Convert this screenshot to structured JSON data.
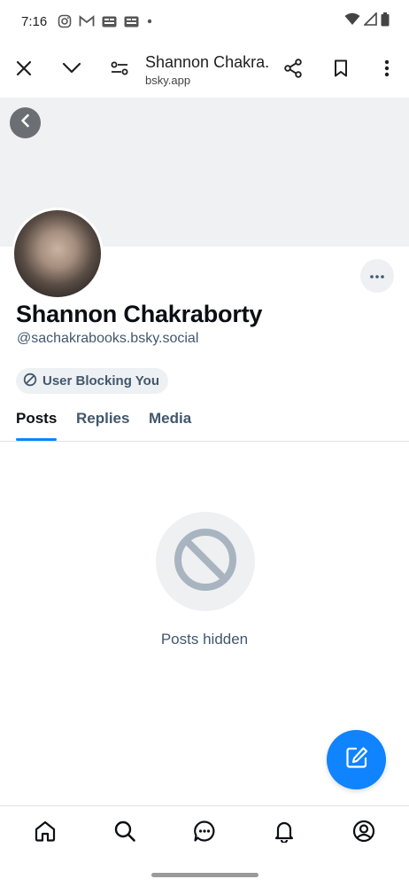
{
  "status_bar": {
    "time": "7:16",
    "notification_icons": [
      "instagram-icon",
      "gmail-icon",
      "news-icon",
      "news-icon",
      "dot-icon"
    ],
    "system_icons": [
      "wifi-icon",
      "signal-icon",
      "battery-icon"
    ]
  },
  "browser_toolbar": {
    "title": "Shannon Chakra...",
    "url": "bsky.app",
    "icons": [
      "close-icon",
      "chevron-down-icon",
      "page-settings-icon",
      "share-icon",
      "bookmark-icon",
      "overflow-menu-icon"
    ]
  },
  "profile": {
    "display_name": "Shannon Chakraborty",
    "handle": "@sachakrabooks.bsky.social",
    "blocking_badge": "User Blocking You"
  },
  "tabs": [
    {
      "label": "Posts",
      "active": true
    },
    {
      "label": "Replies",
      "active": false
    },
    {
      "label": "Media",
      "active": false
    }
  ],
  "empty_state": {
    "label": "Posts hidden",
    "icon": "blocked-icon"
  },
  "bottom_nav": [
    "home-icon",
    "search-icon",
    "chat-icon",
    "notifications-icon",
    "profile-icon"
  ],
  "colors": {
    "accent": "#1083fe",
    "muted_text": "#42576c",
    "banner": "#eff1f3"
  }
}
